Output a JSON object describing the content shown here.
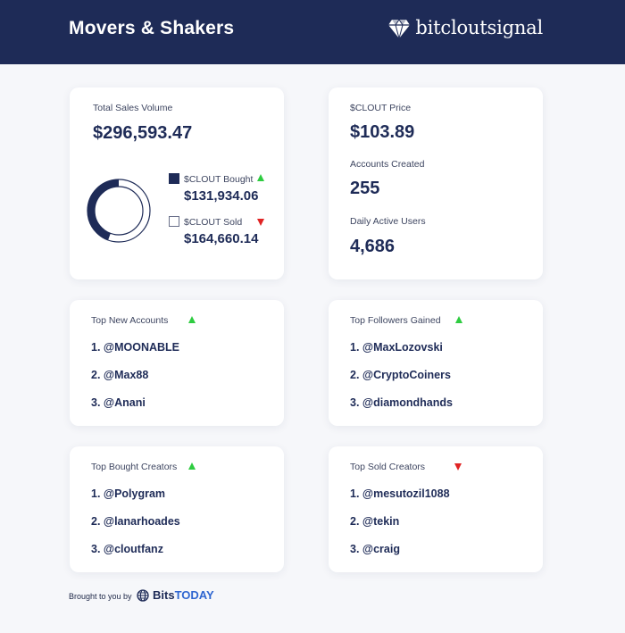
{
  "header": {
    "title": "Movers & Shakers",
    "brand": "bitcloutsignal",
    "background": "#1e2b57"
  },
  "sales": {
    "label": "Total Sales Volume",
    "total": "$296,593.47",
    "bought_label": "$CLOUT Bought",
    "bought_value": "$131,934.06",
    "bought_trend": "up",
    "sold_label": "$CLOUT Sold",
    "sold_value": "$164,660.14",
    "sold_trend": "down",
    "bought_fraction": 0.4448
  },
  "stats": {
    "price_label": "$CLOUT Price",
    "price_value": "$103.89",
    "accounts_label": "Accounts Created",
    "accounts_value": "255",
    "dau_label": "Daily Active Users",
    "dau_value": "4,686"
  },
  "lists": {
    "new_accounts": {
      "title": "Top New Accounts",
      "trend": "up",
      "items": [
        "1. @MOONABLE",
        "2. @Max88",
        "3. @Anani"
      ]
    },
    "followers_gained": {
      "title": "Top Followers Gained",
      "trend": "up",
      "items": [
        "1. @MaxLozovski",
        "2. @CryptoCoiners",
        "3. @diamondhands"
      ]
    },
    "bought_creators": {
      "title": "Top Bought Creators",
      "trend": "up",
      "items": [
        "1. @Polygram",
        "2. @lanarhoades",
        "3. @cloutfanz"
      ]
    },
    "sold_creators": {
      "title": "Top Sold Creators",
      "trend": "down",
      "items": [
        "1. @mesutozil1088",
        "2. @tekin",
        "3. @craig"
      ]
    }
  },
  "footer": {
    "text": "Brought to you by",
    "brand_bits": "Bits",
    "brand_today": "TODAY"
  },
  "colors": {
    "navy": "#1e2b57",
    "up": "#2ecc40",
    "down": "#e02424",
    "accent": "#2f66d0"
  }
}
